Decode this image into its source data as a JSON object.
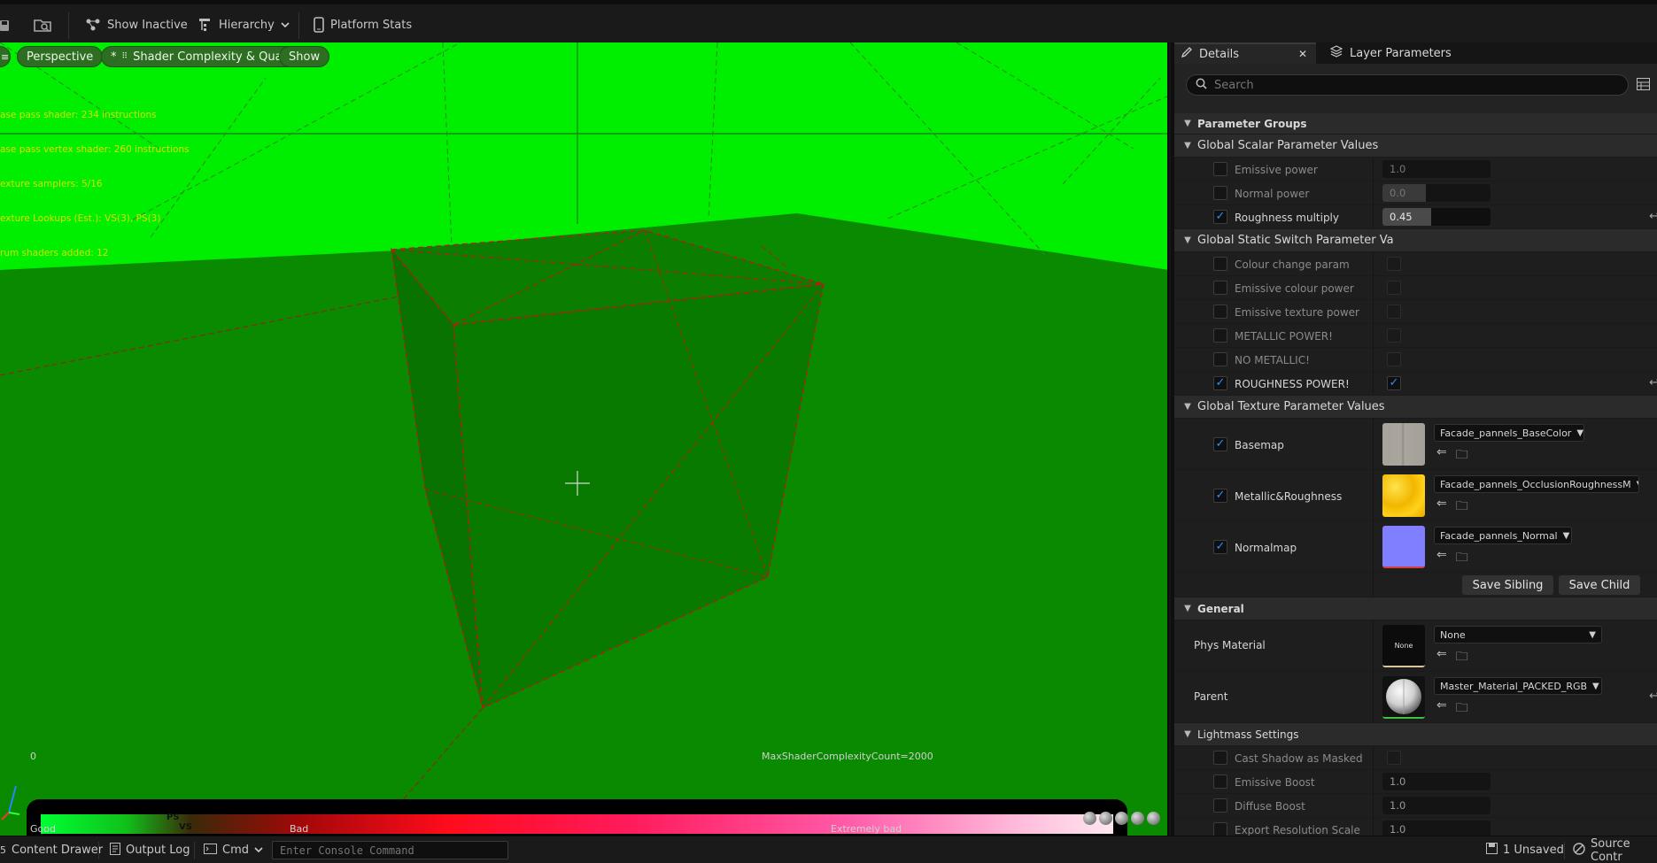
{
  "toolbar": {
    "show_inactive": "Show Inactive",
    "hierarchy": "Hierarchy",
    "platform_stats": "Platform Stats"
  },
  "viewport": {
    "perspective": "Perspective",
    "view_mode": "Shader Complexity & Quads",
    "view_mode_prefix": "*",
    "show": "Show",
    "stats_lines": [
      "ase pass shader: 234 instructions",
      "ase pass vertex shader: 260 instructions",
      "exture samplers: 5/16",
      "exture Lookups (Est.): VS(3), PS(3)",
      "rum shaders added: 12"
    ],
    "complexity_bar": {
      "zero": "0",
      "max_label": "MaxShaderComplexityCount=2000",
      "good": "Good",
      "ps": "PS",
      "vs": "VS",
      "bad": "Bad",
      "extremely_bad": "Extremely bad"
    }
  },
  "details": {
    "tab_details": "Details",
    "tab_layers": "Layer Parameters",
    "search_placeholder": "Search",
    "parameter_groups": "Parameter Groups",
    "scalar_group": "Global Scalar Parameter Values",
    "scalars": [
      {
        "name": "Emissive power",
        "value": "1.0",
        "enabled": false,
        "fill": 0
      },
      {
        "name": "Normal power",
        "value": "0.0",
        "enabled": false,
        "fill": 0.4
      },
      {
        "name": "Roughness multiply",
        "value": "0.45",
        "enabled": true,
        "fill": 0.45
      }
    ],
    "switch_group": "Global Static Switch Parameter Va",
    "switches": [
      {
        "name": "Colour change param",
        "enabled": false,
        "value": false
      },
      {
        "name": "Emissive colour power",
        "enabled": false,
        "value": false
      },
      {
        "name": "Emissive texture power",
        "enabled": false,
        "value": false
      },
      {
        "name": "METALLIC POWER!",
        "enabled": false,
        "value": false
      },
      {
        "name": "NO METALLIC!",
        "enabled": false,
        "value": false
      },
      {
        "name": "ROUGHNESS POWER!",
        "enabled": true,
        "value": true
      }
    ],
    "texture_group": "Global Texture Parameter Values",
    "textures": [
      {
        "name": "Basemap",
        "asset": "Facade_pannels_BaseColor",
        "enabled": true
      },
      {
        "name": "Metallic&Roughness",
        "asset": "Facade_pannels_OcclusionRoughnessM",
        "enabled": true
      },
      {
        "name": "Normalmap",
        "asset": "Facade_pannels_Normal",
        "enabled": true
      }
    ],
    "save_sibling": "Save Sibling",
    "save_child": "Save Child",
    "general_group": "General",
    "phys_material_label": "Phys Material",
    "phys_material_value": "None",
    "phys_material_thumb": "None",
    "parent_label": "Parent",
    "parent_value": "Master_Material_PACKED_RGB",
    "lightmass_group": "Lightmass Settings",
    "lightmass": [
      {
        "name": "Cast Shadow as Masked",
        "kind": "bool"
      },
      {
        "name": "Emissive Boost",
        "kind": "num",
        "value": "1.0"
      },
      {
        "name": "Diffuse Boost",
        "kind": "num",
        "value": "1.0"
      },
      {
        "name": "Export Resolution Scale",
        "kind": "num",
        "value": "1.0"
      }
    ]
  },
  "statusbar": {
    "content_drawer": "Content Drawer",
    "output_log": "Output Log",
    "cmd": "Cmd",
    "console_placeholder": "Enter Console Command",
    "unsaved": "1 Unsaved",
    "source_control": "Source Contr"
  },
  "colors": {
    "viewport_green": "#0a8a00",
    "sky_green": "#00ee00",
    "checkbox_blue": "#2a8fff"
  }
}
